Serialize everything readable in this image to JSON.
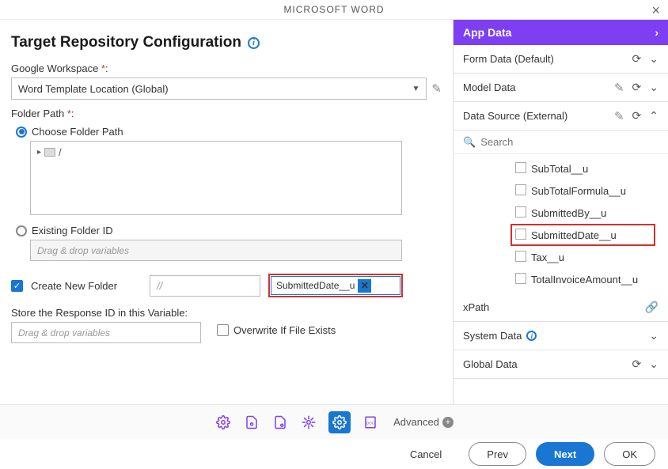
{
  "header": {
    "title": "MICROSOFT WORD"
  },
  "section": {
    "title": "Target Repository Configuration",
    "workspace_label": "Google Workspace",
    "workspace_value": "Word Template Location (Global)",
    "folder_label": "Folder Path",
    "choose_label": "Choose Folder Path",
    "tree_root": "/",
    "existing_label": "Existing Folder ID",
    "existing_placeholder": "Drag & drop variables",
    "create_label": "Create New Folder",
    "path_prefix": "//",
    "chip_value": "SubmittedDate__u",
    "store_label": "Store the Response ID in this Variable:",
    "store_placeholder": "Drag & drop variables",
    "overwrite_label": "Overwrite If File Exists"
  },
  "panel": {
    "title": "App Data",
    "form_data": "Form Data (Default)",
    "model_data": "Model Data",
    "data_source": "Data Source (External)",
    "search_placeholder": "Search",
    "items": [
      "SubTotal__u",
      "SubTotalFormula__u",
      "SubmittedBy__u",
      "SubmittedDate__u",
      "Tax__u",
      "TotalInvoiceAmount__u"
    ],
    "xpath": "xPath",
    "system_data": "System Data",
    "global_data": "Global Data"
  },
  "toolbar": {
    "advanced": "Advanced"
  },
  "footer": {
    "cancel": "Cancel",
    "prev": "Prev",
    "next": "Next",
    "ok": "OK"
  }
}
